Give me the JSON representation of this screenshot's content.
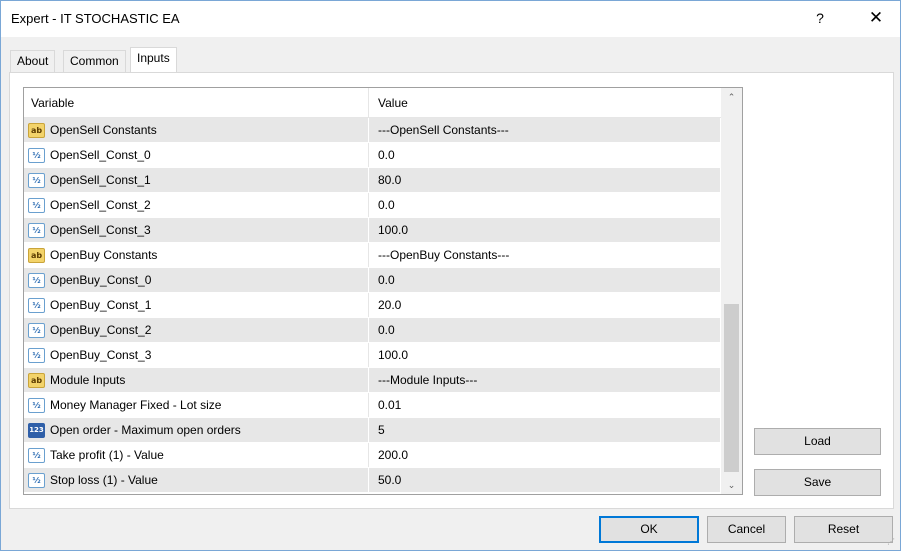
{
  "window": {
    "title": "Expert - IT STOCHASTIC EA",
    "help_label": "?",
    "close_label": "✕"
  },
  "tabs": [
    {
      "label": "About"
    },
    {
      "label": "Common"
    },
    {
      "label": "Inputs",
      "active": true
    }
  ],
  "grid": {
    "headers": {
      "variable": "Variable",
      "value": "Value"
    },
    "rows": [
      {
        "icon": "ab",
        "variable": "OpenSell Constants",
        "value": "---OpenSell Constants---"
      },
      {
        "icon": "v2",
        "variable": "OpenSell_Const_0",
        "value": "0.0"
      },
      {
        "icon": "v2",
        "variable": "OpenSell_Const_1",
        "value": "80.0"
      },
      {
        "icon": "v2",
        "variable": "OpenSell_Const_2",
        "value": "0.0"
      },
      {
        "icon": "v2",
        "variable": "OpenSell_Const_3",
        "value": "100.0"
      },
      {
        "icon": "ab",
        "variable": "OpenBuy Constants",
        "value": "---OpenBuy Constants---"
      },
      {
        "icon": "v2",
        "variable": "OpenBuy_Const_0",
        "value": "0.0"
      },
      {
        "icon": "v2",
        "variable": "OpenBuy_Const_1",
        "value": "20.0"
      },
      {
        "icon": "v2",
        "variable": "OpenBuy_Const_2",
        "value": "0.0"
      },
      {
        "icon": "v2",
        "variable": "OpenBuy_Const_3",
        "value": "100.0"
      },
      {
        "icon": "ab",
        "variable": "Module Inputs",
        "value": "---Module Inputs---"
      },
      {
        "icon": "v2",
        "variable": "Money Manager Fixed - Lot size",
        "value": "0.01"
      },
      {
        "icon": "123",
        "variable": "Open order - Maximum open orders",
        "value": "5"
      },
      {
        "icon": "v2",
        "variable": "Take profit (1) - Value",
        "value": "200.0"
      },
      {
        "icon": "v2",
        "variable": "Stop loss (1) - Value",
        "value": "50.0"
      }
    ],
    "icon_glyphs": {
      "ab": "ab",
      "v2": "½",
      "123": "123"
    },
    "scroll_up_icon": "chevron-up-icon",
    "scroll_down_icon": "chevron-down-icon",
    "scroll_up_glyph": "⌃",
    "scroll_down_glyph": "⌄"
  },
  "side_buttons": {
    "load": "Load",
    "save": "Save"
  },
  "footer_buttons": {
    "ok": "OK",
    "cancel": "Cancel",
    "reset": "Reset"
  },
  "colors": {
    "accent": "#0078d7",
    "row_shade": "#e7e7e7",
    "border": "#7aa7d6"
  }
}
